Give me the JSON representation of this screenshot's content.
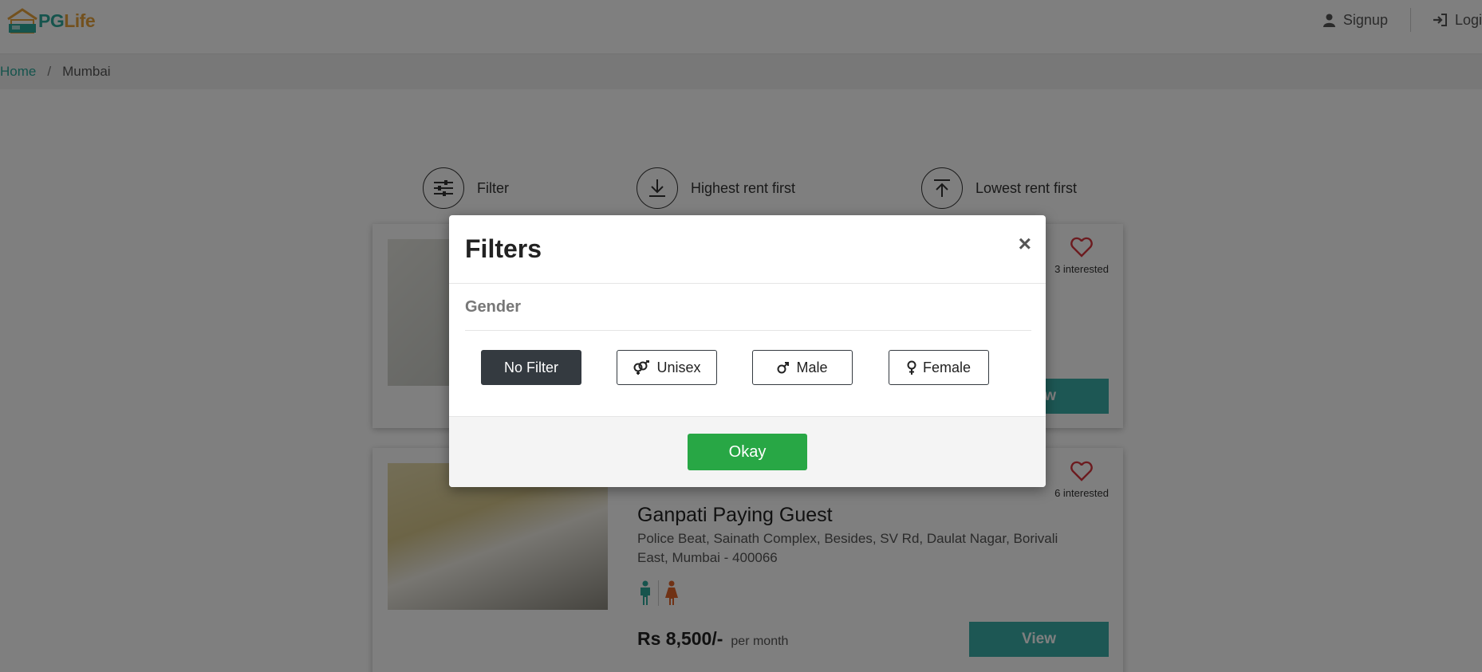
{
  "header": {
    "logo_pg": "PG",
    "logo_life": "Life",
    "signup_label": "Signup",
    "login_label": "Logi"
  },
  "breadcrumb": {
    "home": "Home",
    "separator": "/",
    "current": "Mumbai"
  },
  "sort": {
    "filter_label": "Filter",
    "highest_label": "Highest rent first",
    "lowest_label": "Lowest rent first"
  },
  "cards": [
    {
      "interested": "3 interested",
      "view_label": "View"
    },
    {
      "title": "Ganpati Paying Guest",
      "address": "Police Beat, Sainath Complex, Besides, SV Rd, Daulat Nagar, Borivali East, Mumbai - 400066",
      "interested": "6 interested",
      "price": "Rs 8,500/-",
      "per": "per month",
      "view_label": "View"
    }
  ],
  "modal": {
    "title": "Filters",
    "close": "×",
    "section_title": "Gender",
    "options": [
      "No Filter",
      "Unisex",
      "Male",
      "Female"
    ],
    "selected": "No Filter",
    "okay_label": "Okay"
  },
  "colors": {
    "brand_teal": "#2ca89a",
    "brand_orange": "#e6a23c",
    "view_button": "#3aafa9",
    "okay_button": "#28a745",
    "active_filter": "#343a40",
    "heart": "#d9363e"
  }
}
